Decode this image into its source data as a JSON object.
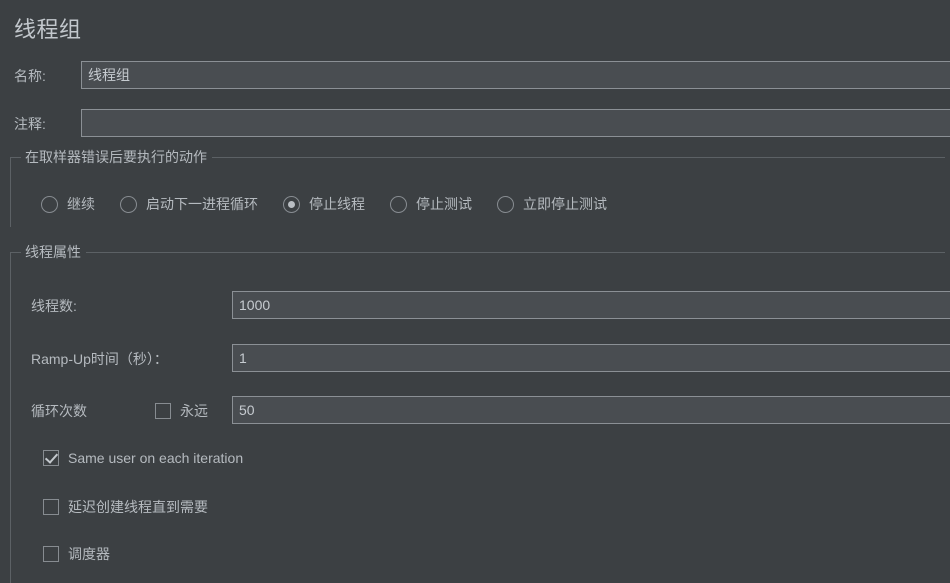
{
  "window": {
    "title": "线程组",
    "background_color": "#3c4043",
    "text_color": "#b5babf",
    "input_background_color": "#494d51",
    "border_color": "#8b9095"
  },
  "header": {
    "title": "线程组"
  },
  "name_field": {
    "label": "名称:",
    "value": "线程组",
    "placeholder": ""
  },
  "comment_field": {
    "label": "注释:",
    "value": "",
    "placeholder": ""
  },
  "sampler_error_group": {
    "legend": "在取样器错误后要执行的动作",
    "selected": "停止线程",
    "options": [
      {
        "label": "继续",
        "checked": false
      },
      {
        "label": "启动下一进程循环",
        "checked": false
      },
      {
        "label": "停止线程",
        "checked": true
      },
      {
        "label": "停止测试",
        "checked": false
      },
      {
        "label": "立即停止测试",
        "checked": false
      }
    ]
  },
  "thread_properties_group": {
    "legend": "线程属性",
    "thread_count": {
      "label": "线程数:",
      "value": "1000"
    },
    "ramp_up": {
      "label": "Ramp-Up时间（秒）：",
      "value": "1"
    },
    "loop_count": {
      "label": "循环次数",
      "forever_label": "永远",
      "forever_checked": false,
      "value": "50"
    },
    "checkboxes": [
      {
        "label": "Same user on each iteration",
        "checked": true
      },
      {
        "label": "延迟创建线程直到需要",
        "checked": false
      },
      {
        "label": "调度器",
        "checked": false
      }
    ]
  }
}
